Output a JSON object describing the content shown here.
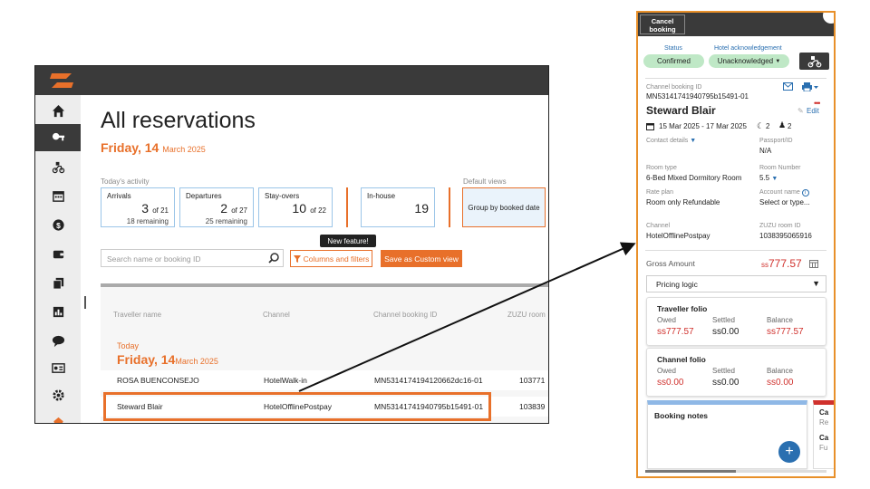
{
  "colors": {
    "brand": "#e8702a",
    "topbar": "#3a3a3a",
    "accent_blue": "#2a6fb0",
    "pill_green": "#bfe8c6",
    "red": "#d0312d"
  },
  "sidebar": {
    "icons": [
      "home-icon",
      "key-icon",
      "scooter-icon",
      "calendar-icon",
      "dollar-icon",
      "wallet-icon",
      "copy-icon",
      "report-icon",
      "chat-icon",
      "id-card-icon",
      "gear-icon",
      "building-icon"
    ]
  },
  "page": {
    "title": "All reservations",
    "date_day": "Friday, 14",
    "date_month": "March 2025",
    "todays_activity_label": "Today's activity",
    "default_views_label": "Default views"
  },
  "stats": {
    "arrivals": {
      "label": "Arrivals",
      "value": "3",
      "of": "of 21",
      "remaining": "18 remaining"
    },
    "departures": {
      "label": "Departures",
      "value": "2",
      "of": "of 27",
      "remaining": "25 remaining"
    },
    "stayovers": {
      "label": "Stay-overs",
      "value": "10",
      "of": "of 22"
    },
    "inhouse": {
      "label": "In-house",
      "value": "19"
    },
    "group_by": "Group by booked date"
  },
  "toolbar": {
    "search_placeholder": "Search name or booking ID",
    "columns_label": "Columns and filters",
    "save_label": "Save as Custom view",
    "tooltip": "New feature!"
  },
  "table": {
    "headers": [
      "Traveller name",
      "Channel",
      "Channel booking ID",
      "ZUZU room"
    ],
    "section_today": "Today",
    "section_day": "Friday, 14",
    "section_month": "March 2025",
    "rows": [
      {
        "name": "ROSA BUENCONSEJO",
        "channel": "HotelWalk-in",
        "booking_id": "MN5314174194120662dc16-01",
        "room": "103771"
      },
      {
        "name": "Steward Blair",
        "channel": "HotelOfflinePostpay",
        "booking_id": "MN53141741940795b15491-01",
        "room": "103839"
      }
    ]
  },
  "panel": {
    "cancel_line1": "Cancel",
    "cancel_line2": "booking",
    "status_label": "Status",
    "status_value": "Confirmed",
    "ack_label": "Hotel acknowledgement",
    "ack_value": "Unacknowledged",
    "channel_booking_label": "Channel booking ID",
    "channel_booking_id": "MN53141741940795b15491-01",
    "guest_name": "Steward Blair",
    "edit_label": "Edit",
    "dates": "15 Mar 2025 - 17 Mar 2025",
    "nights": "2",
    "guests": "2",
    "contact_label": "Contact details",
    "passport_label": "Passport/ID",
    "passport_value": "N/A",
    "room_type_label": "Room type",
    "room_type_value": "6-Bed Mixed Dormitory Room",
    "room_number_label": "Room Number",
    "room_number_value": "5.5",
    "rate_plan_label": "Rate plan",
    "rate_plan_value": "Room only Refundable",
    "account_name_label": "Account name",
    "account_name_value": "Select or type...",
    "channel_label": "Channel",
    "channel_value": "HotelOfflinePostpay",
    "zuzu_room_label": "ZUZU room ID",
    "zuzu_room_value": "1038395065916",
    "gross_label": "Gross Amount",
    "gross_currency": "ss",
    "gross_value": "777.57",
    "pricing_label": "Pricing logic",
    "traveller_folio": {
      "title": "Traveller folio",
      "owed_label": "Owed",
      "settled_label": "Settled",
      "balance_label": "Balance",
      "owed": "ss777.57",
      "settled": "ss0.00",
      "balance": "ss777.57"
    },
    "channel_folio": {
      "title": "Channel folio",
      "owed_label": "Owed",
      "settled_label": "Settled",
      "balance_label": "Balance",
      "owed": "ss0.00",
      "settled": "ss0.00",
      "balance": "ss0.00"
    },
    "notes_label": "Booking notes",
    "side_card_1": "Ca",
    "side_card_1b": "Re",
    "side_card_2": "Ca",
    "side_card_2b": "Fu"
  }
}
